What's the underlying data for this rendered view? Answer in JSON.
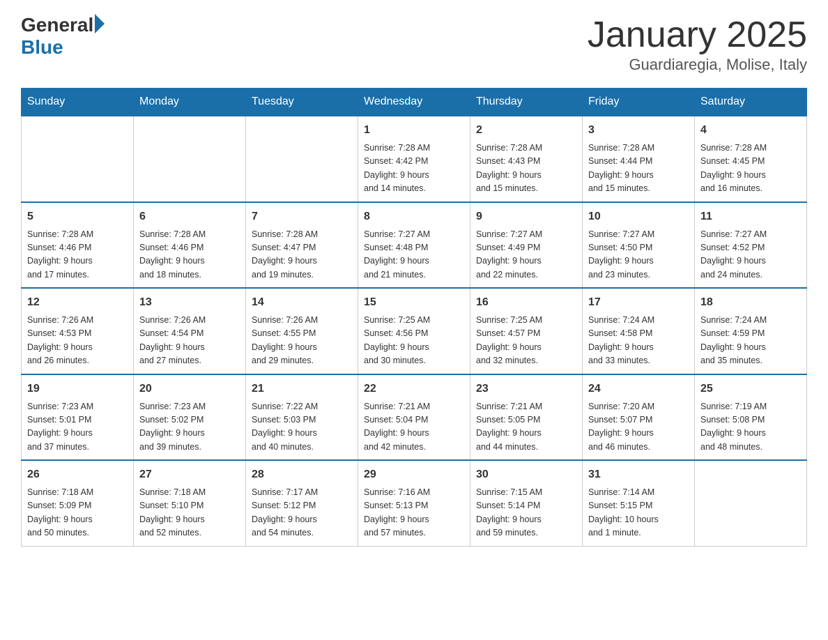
{
  "header": {
    "logo_general": "General",
    "logo_blue": "Blue",
    "title": "January 2025",
    "location": "Guardiaregia, Molise, Italy"
  },
  "days_of_week": [
    "Sunday",
    "Monday",
    "Tuesday",
    "Wednesday",
    "Thursday",
    "Friday",
    "Saturday"
  ],
  "weeks": [
    [
      {
        "day": "",
        "info": ""
      },
      {
        "day": "",
        "info": ""
      },
      {
        "day": "",
        "info": ""
      },
      {
        "day": "1",
        "info": "Sunrise: 7:28 AM\nSunset: 4:42 PM\nDaylight: 9 hours\nand 14 minutes."
      },
      {
        "day": "2",
        "info": "Sunrise: 7:28 AM\nSunset: 4:43 PM\nDaylight: 9 hours\nand 15 minutes."
      },
      {
        "day": "3",
        "info": "Sunrise: 7:28 AM\nSunset: 4:44 PM\nDaylight: 9 hours\nand 15 minutes."
      },
      {
        "day": "4",
        "info": "Sunrise: 7:28 AM\nSunset: 4:45 PM\nDaylight: 9 hours\nand 16 minutes."
      }
    ],
    [
      {
        "day": "5",
        "info": "Sunrise: 7:28 AM\nSunset: 4:46 PM\nDaylight: 9 hours\nand 17 minutes."
      },
      {
        "day": "6",
        "info": "Sunrise: 7:28 AM\nSunset: 4:46 PM\nDaylight: 9 hours\nand 18 minutes."
      },
      {
        "day": "7",
        "info": "Sunrise: 7:28 AM\nSunset: 4:47 PM\nDaylight: 9 hours\nand 19 minutes."
      },
      {
        "day": "8",
        "info": "Sunrise: 7:27 AM\nSunset: 4:48 PM\nDaylight: 9 hours\nand 21 minutes."
      },
      {
        "day": "9",
        "info": "Sunrise: 7:27 AM\nSunset: 4:49 PM\nDaylight: 9 hours\nand 22 minutes."
      },
      {
        "day": "10",
        "info": "Sunrise: 7:27 AM\nSunset: 4:50 PM\nDaylight: 9 hours\nand 23 minutes."
      },
      {
        "day": "11",
        "info": "Sunrise: 7:27 AM\nSunset: 4:52 PM\nDaylight: 9 hours\nand 24 minutes."
      }
    ],
    [
      {
        "day": "12",
        "info": "Sunrise: 7:26 AM\nSunset: 4:53 PM\nDaylight: 9 hours\nand 26 minutes."
      },
      {
        "day": "13",
        "info": "Sunrise: 7:26 AM\nSunset: 4:54 PM\nDaylight: 9 hours\nand 27 minutes."
      },
      {
        "day": "14",
        "info": "Sunrise: 7:26 AM\nSunset: 4:55 PM\nDaylight: 9 hours\nand 29 minutes."
      },
      {
        "day": "15",
        "info": "Sunrise: 7:25 AM\nSunset: 4:56 PM\nDaylight: 9 hours\nand 30 minutes."
      },
      {
        "day": "16",
        "info": "Sunrise: 7:25 AM\nSunset: 4:57 PM\nDaylight: 9 hours\nand 32 minutes."
      },
      {
        "day": "17",
        "info": "Sunrise: 7:24 AM\nSunset: 4:58 PM\nDaylight: 9 hours\nand 33 minutes."
      },
      {
        "day": "18",
        "info": "Sunrise: 7:24 AM\nSunset: 4:59 PM\nDaylight: 9 hours\nand 35 minutes."
      }
    ],
    [
      {
        "day": "19",
        "info": "Sunrise: 7:23 AM\nSunset: 5:01 PM\nDaylight: 9 hours\nand 37 minutes."
      },
      {
        "day": "20",
        "info": "Sunrise: 7:23 AM\nSunset: 5:02 PM\nDaylight: 9 hours\nand 39 minutes."
      },
      {
        "day": "21",
        "info": "Sunrise: 7:22 AM\nSunset: 5:03 PM\nDaylight: 9 hours\nand 40 minutes."
      },
      {
        "day": "22",
        "info": "Sunrise: 7:21 AM\nSunset: 5:04 PM\nDaylight: 9 hours\nand 42 minutes."
      },
      {
        "day": "23",
        "info": "Sunrise: 7:21 AM\nSunset: 5:05 PM\nDaylight: 9 hours\nand 44 minutes."
      },
      {
        "day": "24",
        "info": "Sunrise: 7:20 AM\nSunset: 5:07 PM\nDaylight: 9 hours\nand 46 minutes."
      },
      {
        "day": "25",
        "info": "Sunrise: 7:19 AM\nSunset: 5:08 PM\nDaylight: 9 hours\nand 48 minutes."
      }
    ],
    [
      {
        "day": "26",
        "info": "Sunrise: 7:18 AM\nSunset: 5:09 PM\nDaylight: 9 hours\nand 50 minutes."
      },
      {
        "day": "27",
        "info": "Sunrise: 7:18 AM\nSunset: 5:10 PM\nDaylight: 9 hours\nand 52 minutes."
      },
      {
        "day": "28",
        "info": "Sunrise: 7:17 AM\nSunset: 5:12 PM\nDaylight: 9 hours\nand 54 minutes."
      },
      {
        "day": "29",
        "info": "Sunrise: 7:16 AM\nSunset: 5:13 PM\nDaylight: 9 hours\nand 57 minutes."
      },
      {
        "day": "30",
        "info": "Sunrise: 7:15 AM\nSunset: 5:14 PM\nDaylight: 9 hours\nand 59 minutes."
      },
      {
        "day": "31",
        "info": "Sunrise: 7:14 AM\nSunset: 5:15 PM\nDaylight: 10 hours\nand 1 minute."
      },
      {
        "day": "",
        "info": ""
      }
    ]
  ]
}
